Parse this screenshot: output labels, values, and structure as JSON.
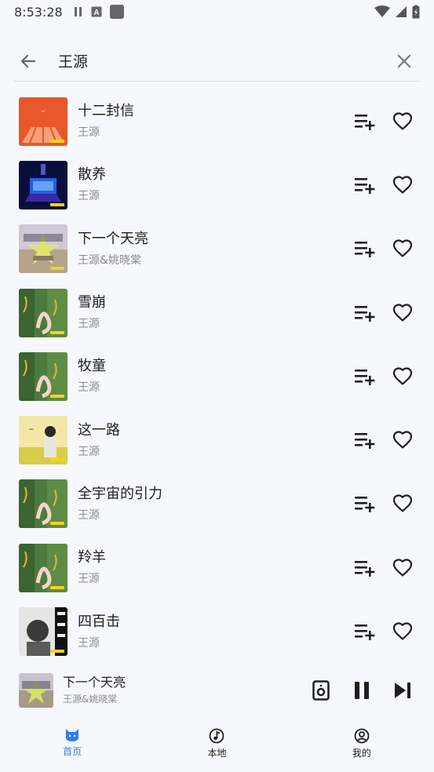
{
  "status": {
    "time": "8:53:28"
  },
  "search": {
    "query": "王源"
  },
  "songs": [
    {
      "title": "十二封信",
      "artist": "王源",
      "cover": "orange"
    },
    {
      "title": "散养",
      "artist": "王源",
      "cover": "blue"
    },
    {
      "title": "下一个天亮",
      "artist": "王源&姚晓棠",
      "cover": "star"
    },
    {
      "title": "雪崩",
      "artist": "王源",
      "cover": "green"
    },
    {
      "title": "牧童",
      "artist": "王源",
      "cover": "green"
    },
    {
      "title": "这一路",
      "artist": "王源",
      "cover": "yellow"
    },
    {
      "title": "全宇宙的引力",
      "artist": "王源",
      "cover": "green"
    },
    {
      "title": "羚羊",
      "artist": "王源",
      "cover": "green"
    },
    {
      "title": "四百击",
      "artist": "王源",
      "cover": "bw"
    }
  ],
  "now_playing": {
    "title": "下一个天亮",
    "artist": "王源&姚晓棠"
  },
  "nav": {
    "home": "首页",
    "local": "本地",
    "mine": "我的"
  },
  "colors": {
    "accent": "#2c7df0",
    "background": "#f7f8fd"
  }
}
